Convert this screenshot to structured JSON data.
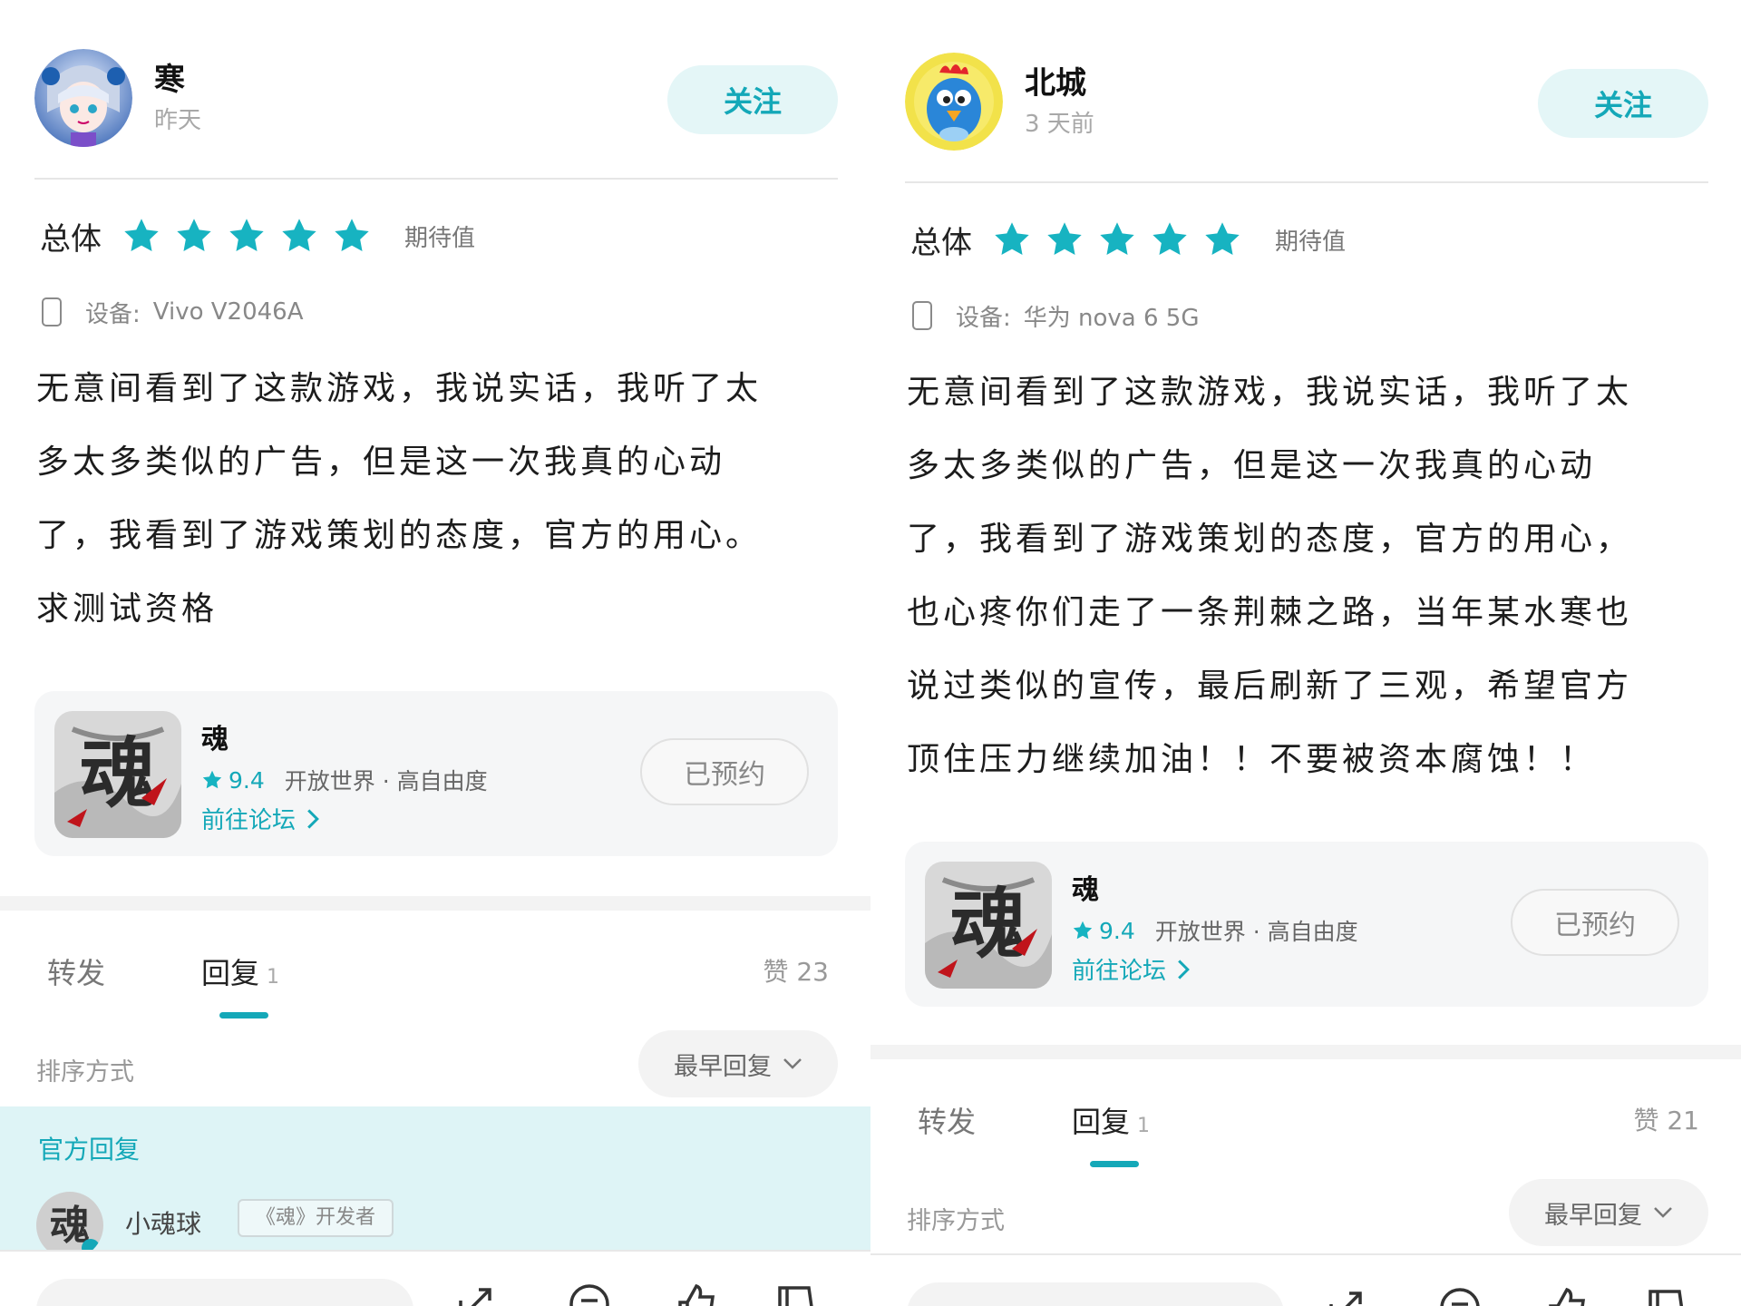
{
  "colors": {
    "accent": "#14a8b8",
    "star": "#17b3c1"
  },
  "left": {
    "username": "寒",
    "time": "昨天",
    "follow_label": "关注",
    "rating_label": "总体",
    "stars": 5,
    "expect_label": "期待值",
    "device_prefix": "设备:",
    "device_name": "Vivo V2046A",
    "body_lines": [
      "无意间看到了这款游戏，我说实话，我听了太",
      "多太多类似的广告，但是这一次我真的心动",
      "了，我看到了游戏策划的态度，官方的用心。",
      "求测试资格"
    ],
    "game": {
      "name": "魂",
      "icon_glyph": "魂",
      "score": "9.4",
      "tags": "开放世界 · 高自由度",
      "forum_label": "前往论坛",
      "reserved_label": "已预约"
    },
    "tabs": {
      "forward": "转发",
      "reply": "回复",
      "reply_count": "1",
      "likes": "赞 23"
    },
    "sort": {
      "label": "排序方式",
      "value": "最早回复"
    },
    "official": {
      "label": "官方回复",
      "user": "小魂球",
      "badge": "《魂》开发者",
      "avatar_glyph": "魂"
    }
  },
  "right": {
    "username": "北城",
    "time": "3 天前",
    "follow_label": "关注",
    "rating_label": "总体",
    "stars": 5,
    "expect_label": "期待值",
    "device_prefix": "设备:",
    "device_name": "华为 nova 6 5G",
    "body_lines": [
      "无意间看到了这款游戏，我说实话，我听了太",
      "多太多类似的广告，但是这一次我真的心动",
      "了，我看到了游戏策划的态度，官方的用心，",
      "也心疼你们走了一条荆棘之路，当年某水寒也",
      "说过类似的宣传，最后刷新了三观，希望官方",
      "顶住压力继续加油！！不要被资本腐蚀！！"
    ],
    "game": {
      "name": "魂",
      "icon_glyph": "魂",
      "score": "9.4",
      "tags": "开放世界 · 高自由度",
      "forum_label": "前往论坛",
      "reserved_label": "已预约"
    },
    "tabs": {
      "forward": "转发",
      "reply": "回复",
      "reply_count": "1",
      "likes": "赞 21"
    },
    "sort": {
      "label": "排序方式",
      "value": "最早回复"
    }
  }
}
